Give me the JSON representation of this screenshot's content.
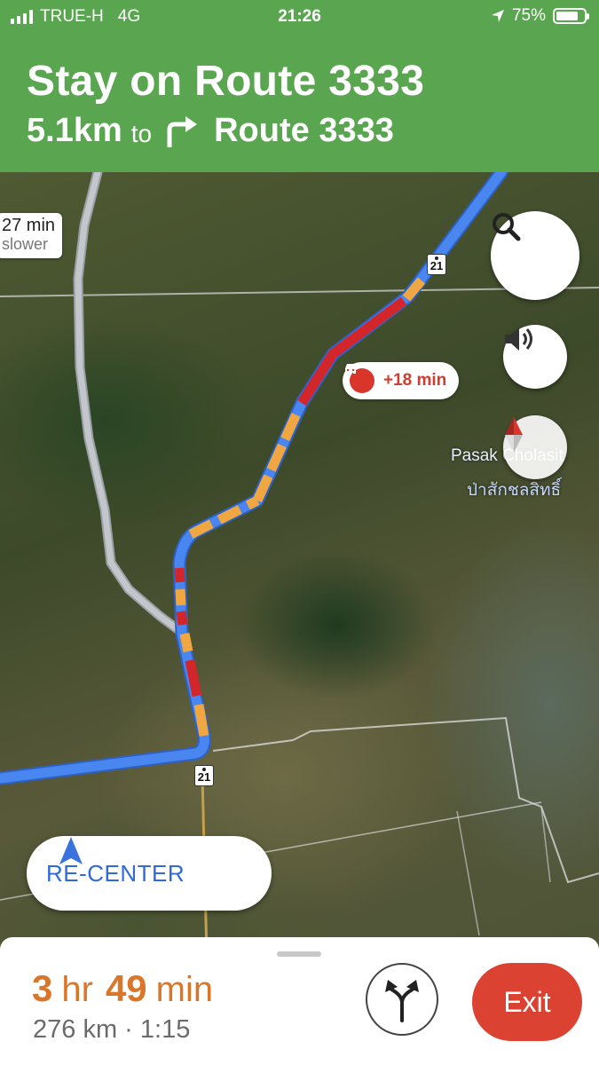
{
  "status_bar": {
    "carrier": "TRUE-H",
    "network": "4G",
    "time": "21:26",
    "battery": "75%",
    "battery_level": 0.75
  },
  "navigation": {
    "instruction": "Stay on Route 3333",
    "distance": "5.1km",
    "to_word": "to",
    "next_maneuver_icon": "turn-right-icon",
    "next_road": "Route 3333",
    "header_color": "#5aa650"
  },
  "map": {
    "alt_route_callout": {
      "time": "27 min",
      "note": "slower"
    },
    "traffic_delay": "+18 min",
    "route_shields": [
      "21",
      "21"
    ],
    "place_name": "Pasak Cholasit",
    "place_name_thai": "ป่าสักชลสิทธิ์",
    "route_color": "#4a86f0",
    "traffic_slow_color": "#f0a742",
    "traffic_jam_color": "#d2262b"
  },
  "controls": {
    "search_icon": "search-icon",
    "sound_icon": "volume-icon",
    "compass_icon": "compass-icon",
    "recenter_label": "RE-CENTER"
  },
  "trip": {
    "hours": "3",
    "hours_unit": "hr",
    "minutes": "49",
    "minutes_unit": "min",
    "distance": "276 km",
    "separator": "·",
    "arrival": "1:15",
    "eta_color": "#d9762a",
    "exit_label": "Exit",
    "exit_color": "#dc4232",
    "alternates_icon": "alternate-routes-icon"
  }
}
